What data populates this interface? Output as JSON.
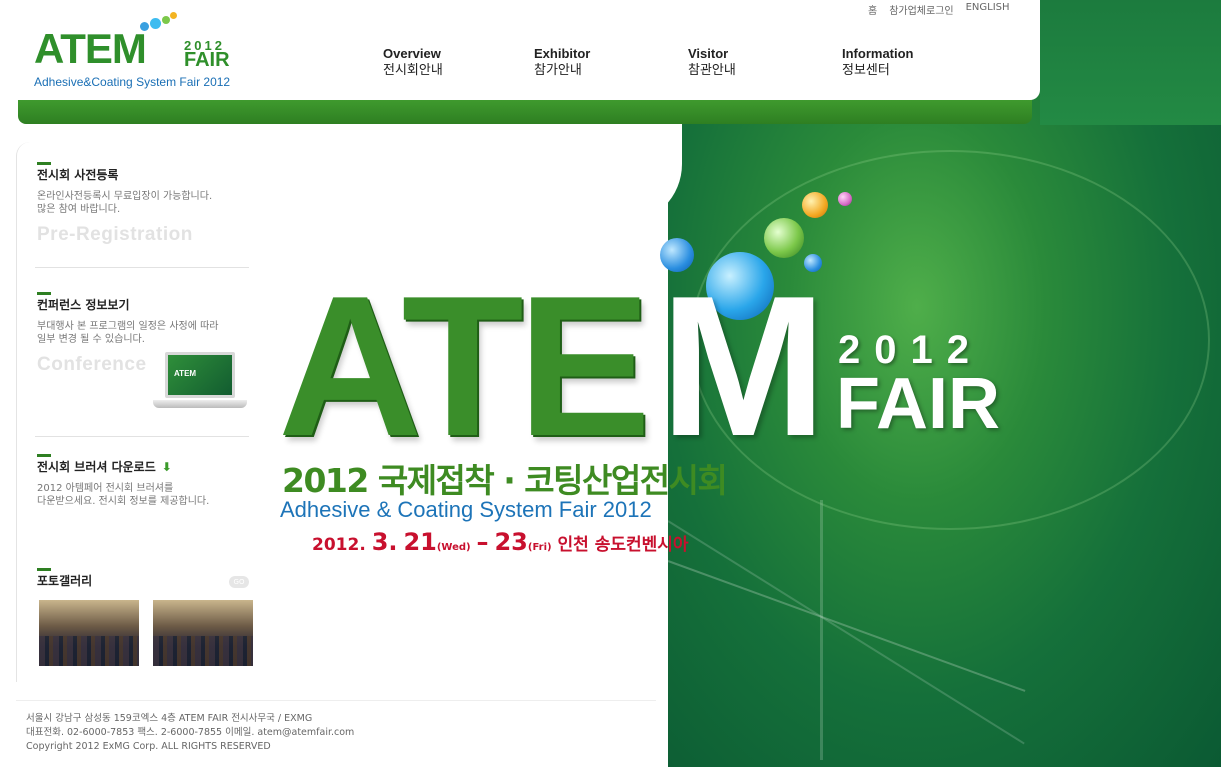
{
  "header": {
    "logo": {
      "brand": "ATEM",
      "year": "2012",
      "fair": "FAIR",
      "subtitle": "Adhesive&Coating System Fair 2012"
    },
    "util_nav": [
      "홈",
      "참가업체로그인",
      "ENGLISH"
    ],
    "gnb": [
      {
        "en": "Overview",
        "ko": "전시회안내"
      },
      {
        "en": "Exhibitor",
        "ko": "참가안내"
      },
      {
        "en": "Visitor",
        "ko": "참관안내"
      },
      {
        "en": "Information",
        "ko": "정보센터"
      }
    ]
  },
  "sidebar": {
    "preregistration": {
      "title": "전시회 사전등록",
      "desc": [
        "온라인사전등록시 무료입장이 가능합니다.",
        "많은 참여 바랍니다."
      ],
      "en": "Pre-Registration"
    },
    "conference": {
      "title": "컨퍼런스 정보보기",
      "desc": [
        "부대행사 본 프로그램의 일정은 사정에 따라",
        "일부 변경 될 수 있습니다."
      ],
      "en": "Conference",
      "laptop_text": "ATEM"
    },
    "brochure": {
      "title": "전시회 브러셔 다운로드",
      "desc": [
        "2012 아템페어 전시회 브러셔를",
        "다운받으세요. 전시회 정보를 제공합니다."
      ]
    },
    "gallery": {
      "title": "포토갤러리",
      "more": "GO"
    }
  },
  "visual": {
    "brand_green": "ATE",
    "brand_white": "M",
    "year": "2012",
    "fair": "FAIR",
    "ko_title": "2012 국제접착 · 코팅산업전시회",
    "en_title": "Adhesive & Coating System Fair 2012",
    "date": {
      "year": "2012.",
      "month": "3.",
      "start_day": "21",
      "start_dow": "(Wed)",
      "dash": "–",
      "end_day": "23",
      "end_dow": "(Fri)",
      "venue": "인천 송도컨벤시아"
    }
  },
  "footer": [
    "서울시 강남구 삼성동 159코엑스 4층 ATEM FAIR 전시사무국 / EXMG",
    "대표전화. 02-6000-7853 팩스. 2-6000-7855 이메일. atem@atemfair.com",
    "Copyright 2012 ExMG Corp. ALL RIGHTS RESERVED"
  ],
  "colors": {
    "brand_green": "#2f8f2b",
    "link_blue": "#1d74b8",
    "date_red": "#c8102e"
  }
}
